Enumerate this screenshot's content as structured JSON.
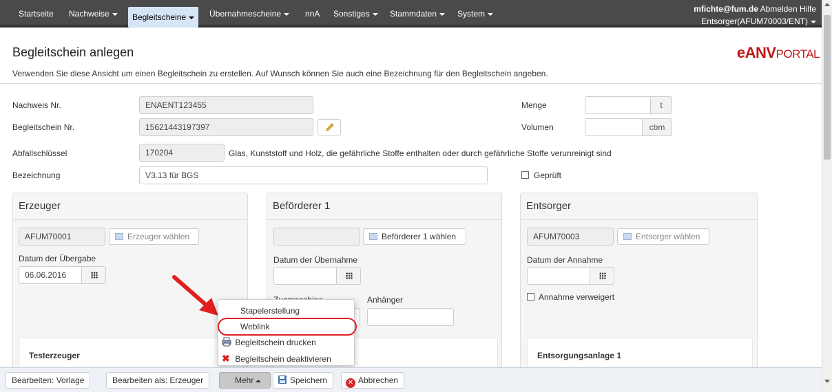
{
  "nav": {
    "items": [
      {
        "label": "Startseite",
        "caret": false
      },
      {
        "label": "Nachweise",
        "caret": true
      },
      {
        "label": "Begleitscheine",
        "caret": true
      },
      {
        "label": "Übernahmescheine",
        "caret": true
      },
      {
        "label": "nnA",
        "caret": false
      },
      {
        "label": "Sonstiges",
        "caret": true
      },
      {
        "label": "Stammdaten",
        "caret": true
      },
      {
        "label": "System",
        "caret": true
      }
    ],
    "active": "Begleitscheine",
    "user_email": "mfichte@fum.de",
    "logout": "Abmelden",
    "help": "Hilfe",
    "role": "Entsorger(AFUM70003/ENT)"
  },
  "page": {
    "title": "Begleitschein anlegen",
    "description": "Verwenden Sie diese Ansicht um einen Begleitschein zu erstellen. Auf Wunsch können Sie auch eine Bezeichnung für den Begleitschein angeben.",
    "logo_bold": "eANV",
    "logo_rest": "PORTAL"
  },
  "form": {
    "nachweis_label": "Nachweis Nr.",
    "nachweis_value": "ENAENT123455",
    "begleitschein_label": "Begleitschein Nr.",
    "begleitschein_value": "15621443197397",
    "abfall_label": "Abfallschlüssel",
    "abfall_value": "170204",
    "abfall_text": "Glas, Kunststoff und Holz, die gefährliche Stoffe enthalten oder durch gefährliche Stoffe verunreinigt sind",
    "bezeichnung_label": "Bezeichnung",
    "bezeichnung_value": "V3.13 für BGS",
    "menge_label": "Menge",
    "menge_unit": "t",
    "volumen_label": "Volumen",
    "volumen_unit": "cbm",
    "geprueft_label": "Geprüft"
  },
  "erzeuger": {
    "title": "Erzeuger",
    "id": "AFUM70001",
    "choose": "Erzeuger wählen",
    "date_label": "Datum der Übergabe",
    "date_value": "06.06.2016",
    "name": "Testerzeuger"
  },
  "befoerderer": {
    "title": "Beförderer 1",
    "id": "",
    "choose": "Beförderer 1 wählen",
    "date_label": "Datum der Übernahme",
    "zug_label": "Zugmaschine",
    "anh_label": "Anhänger"
  },
  "entsorger": {
    "title": "Entsorger",
    "id": "AFUM70003",
    "choose": "Entsorger wählen",
    "date_label": "Datum der Annahme",
    "refuse_label": "Annahme verweigert",
    "anlage": "Entsorgungsanlage 1"
  },
  "dropdown": {
    "items": [
      "Stapelerstellung",
      "Weblink",
      "Begleitschein drucken",
      "Begleitschein deaktivieren"
    ],
    "highlighted": "Weblink"
  },
  "toolbar": {
    "edit_template": "Bearbeiten: Vorlage",
    "edit_as": "Bearbeiten als: Erzeuger",
    "more": "Mehr",
    "save": "Speichern",
    "cancel": "Abbrechen"
  },
  "colors": {
    "navbar": "#4a4a4a",
    "active_tab": "#d6e4f7",
    "logo": "#c01818",
    "annotation": "#e02020"
  }
}
